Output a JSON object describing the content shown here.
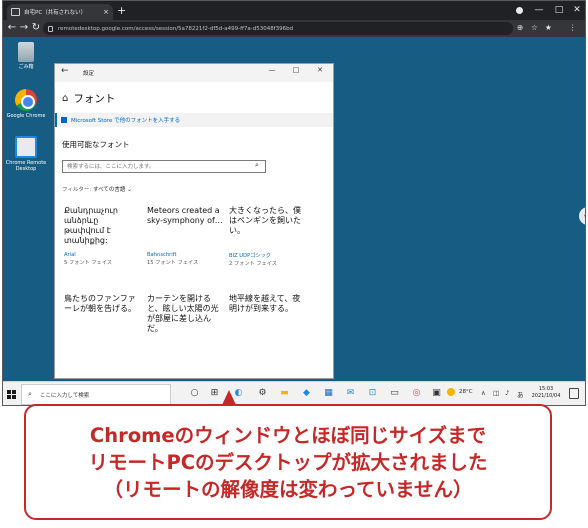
{
  "browser": {
    "tab_title": "自宅PC（共有されない）",
    "tab_close": "×",
    "new_tab": "+",
    "url": "remotedesktop.google.com/access/session/5a78221f2-df5d-a499-ff7a-d53048f396bd",
    "window_controls": [
      "—",
      "□",
      "✕"
    ],
    "nav": {
      "back": "←",
      "forward": "→",
      "reload": "↻"
    },
    "toolbar_icons": [
      "⊕",
      "☆",
      "★",
      "⋮"
    ]
  },
  "desktop": {
    "icons": [
      {
        "label": "ごみ箱",
        "icon": "recycle-bin-icon"
      },
      {
        "label": "Google Chrome",
        "icon": "chrome-icon"
      },
      {
        "label": "Chrome Remote Desktop",
        "icon": "remote-desktop-icon"
      }
    ],
    "side_handle": "‹"
  },
  "settings": {
    "window_title": "設定",
    "back": "←",
    "controls": [
      "—",
      "□",
      "✕"
    ],
    "heading": "フォント",
    "store_link": "Microsoft Store で他のフォントを入手する",
    "available_heading": "使用可能なフォント",
    "search_placeholder": "検索するには、ここに入力します。",
    "search_icon": "⌕",
    "filter_label": "フィルター:",
    "filter_value": "すべての言語",
    "filter_chevron": "⌄",
    "fonts": [
      {
        "sample": "Քանդրաչուր անձրևը թափվում է տանիքից:",
        "name": "Arial",
        "faces": "5 フォント フェイス"
      },
      {
        "sample": "Meteors created a sky-symphony of…",
        "name": "Bahnschrift",
        "faces": "15 フォント フェイス"
      },
      {
        "sample": "大きくなったら、僕はペンギンを飼いたい。",
        "name": "BIZ UDPゴシック",
        "faces": "2 フォント フェイス"
      },
      {
        "sample": "鳥たちのファンファーレが朝を告げる。",
        "name": "",
        "faces": ""
      },
      {
        "sample": "カーテンを開けると、眩しい太陽の光が部屋に差し込んだ。",
        "name": "",
        "faces": ""
      },
      {
        "sample": "地平線を越えて、夜明けが到来する。",
        "name": "",
        "faces": ""
      }
    ]
  },
  "taskbar": {
    "search_text": "ここに入力して検索",
    "apps": [
      "○",
      "⊞",
      "◐",
      "⚙",
      "▬",
      "◆",
      "▦",
      "✉",
      "⊡",
      "✕",
      "▭",
      "◎",
      "▣"
    ],
    "weather": "28°C",
    "tray": [
      "∧",
      "◫",
      "♪",
      "あ"
    ],
    "time": "15:03",
    "date": "2021/10/04"
  },
  "callout": {
    "line1": "Chromeのウィンドウとほぼ同じサイズまで",
    "line2": "リモートPCのデスクトップが拡大されました",
    "line3": "（リモートの解像度は変わっていません）"
  },
  "colors": {
    "desktop": "#175c82",
    "callout": "#c62828",
    "link": "#0067c0"
  }
}
